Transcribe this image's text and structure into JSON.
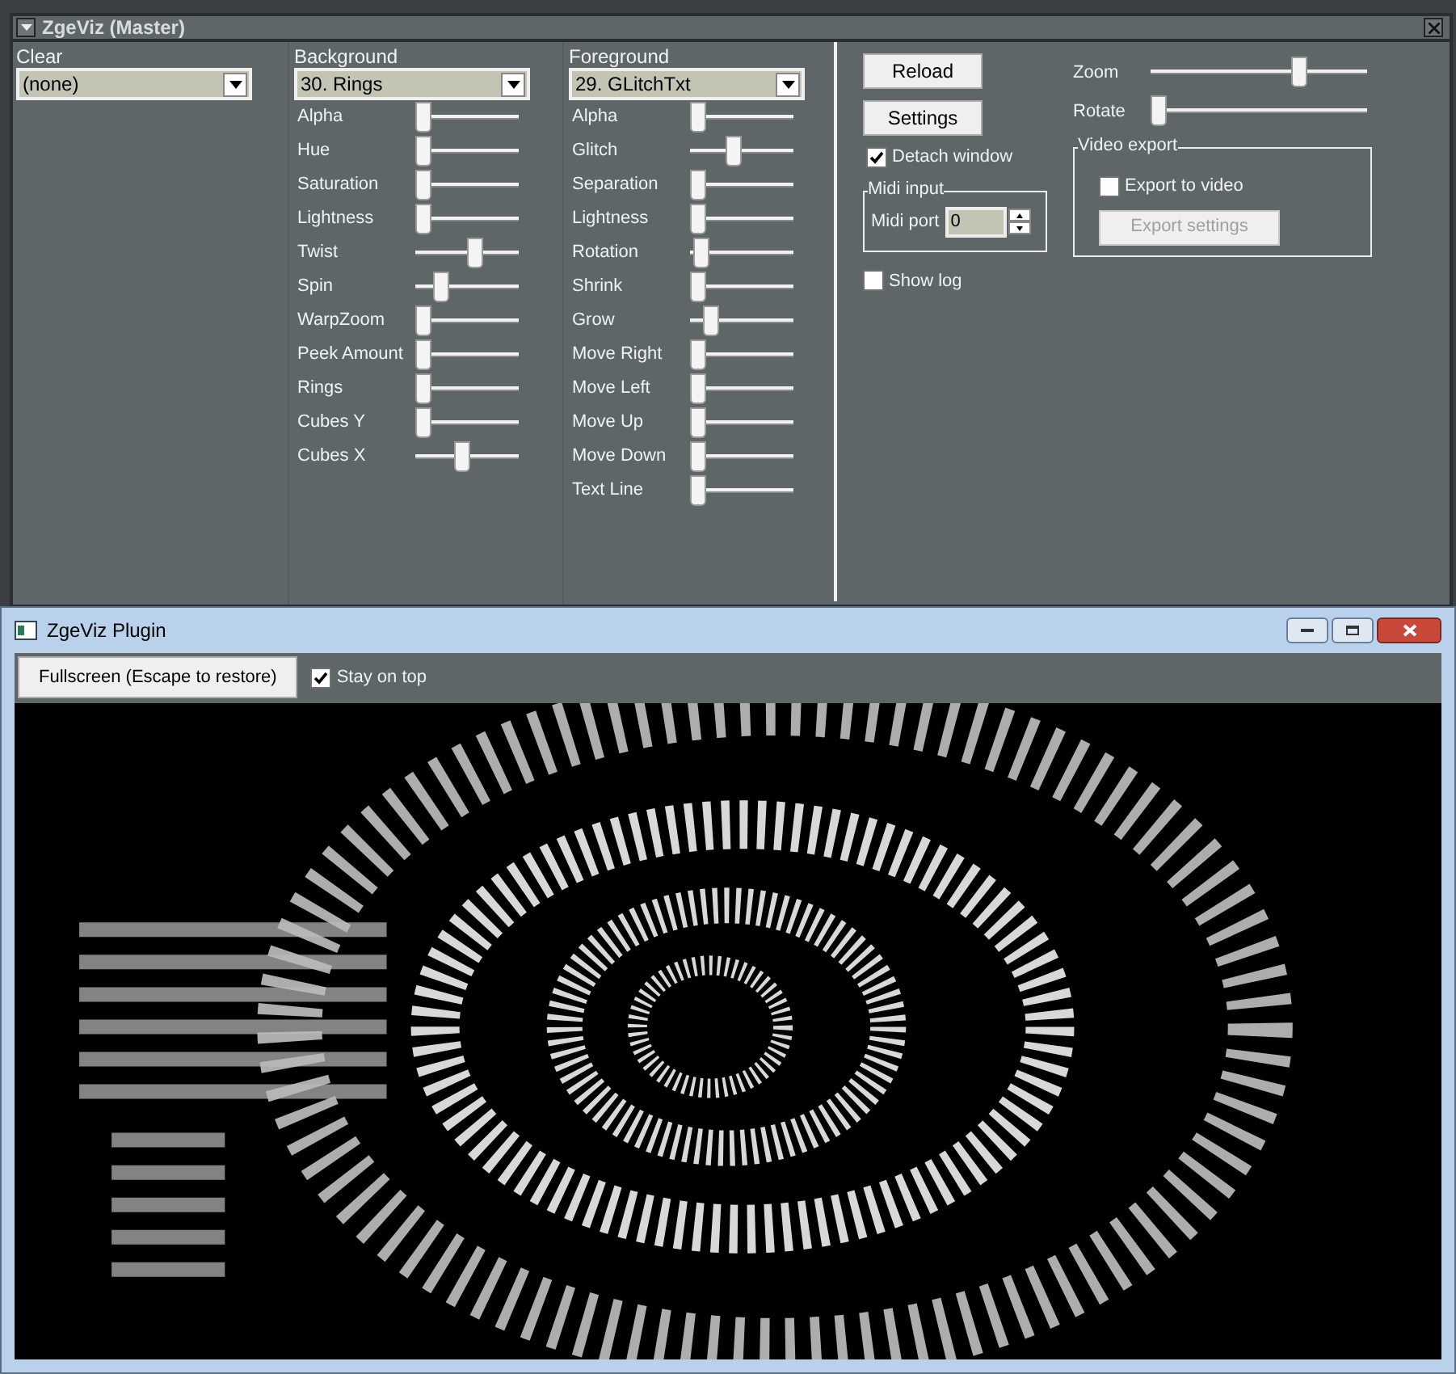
{
  "window": {
    "title": "ZgeViz (Master)"
  },
  "clear": {
    "label": "Clear",
    "value": "(none)"
  },
  "background": {
    "label": "Background",
    "value": "30. Rings",
    "sliders": [
      {
        "label": "Alpha",
        "level": 0
      },
      {
        "label": "Hue",
        "level": 0
      },
      {
        "label": "Saturation",
        "level": 0
      },
      {
        "label": "Lightness",
        "level": 0
      },
      {
        "label": "Twist",
        "level": 0.6
      },
      {
        "label": "Spin",
        "level": 0.2
      },
      {
        "label": "WarpZoom",
        "level": 0
      },
      {
        "label": "Peek Amount",
        "level": 0
      },
      {
        "label": "Rings",
        "level": 0
      },
      {
        "label": "Cubes Y",
        "level": 0
      },
      {
        "label": "Cubes X",
        "level": 0.45
      }
    ]
  },
  "foreground": {
    "label": "Foreground",
    "value": "29. GLitchTxt",
    "sliders": [
      {
        "label": "Alpha",
        "level": 0
      },
      {
        "label": "Glitch",
        "level": 0.4
      },
      {
        "label": "Separation",
        "level": 0
      },
      {
        "label": "Lightness",
        "level": 0
      },
      {
        "label": "Rotation",
        "level": 0.03
      },
      {
        "label": "Shrink",
        "level": 0
      },
      {
        "label": "Grow",
        "level": 0.15
      },
      {
        "label": "Move Right",
        "level": 0
      },
      {
        "label": "Move Left",
        "level": 0
      },
      {
        "label": "Move Up",
        "level": 0
      },
      {
        "label": "Move Down",
        "level": 0
      },
      {
        "label": "Text Line",
        "level": 0
      }
    ]
  },
  "buttons": [
    {
      "label": "Reload"
    },
    {
      "label": "Settings"
    }
  ],
  "detach_window": {
    "label": "Detach window",
    "checked": true
  },
  "midi_input": {
    "title": "Midi input",
    "label": "Midi port",
    "value": "0"
  },
  "show_log": {
    "label": "Show log",
    "checked": false
  },
  "view_sliders": [
    {
      "label": "Zoom",
      "level": 0.7
    },
    {
      "label": "Rotate",
      "level": 0
    }
  ],
  "video_export": {
    "title": "Video export",
    "checkbox": {
      "label": "Export to video",
      "checked": false
    },
    "button": {
      "label": "Export settings",
      "disabled": true
    }
  },
  "plugin_window": {
    "title": "ZgeViz Plugin",
    "fullscreen_button": "Fullscreen (Escape to restore)",
    "stay_on_top": {
      "label": "Stay on top",
      "checked": true
    }
  }
}
